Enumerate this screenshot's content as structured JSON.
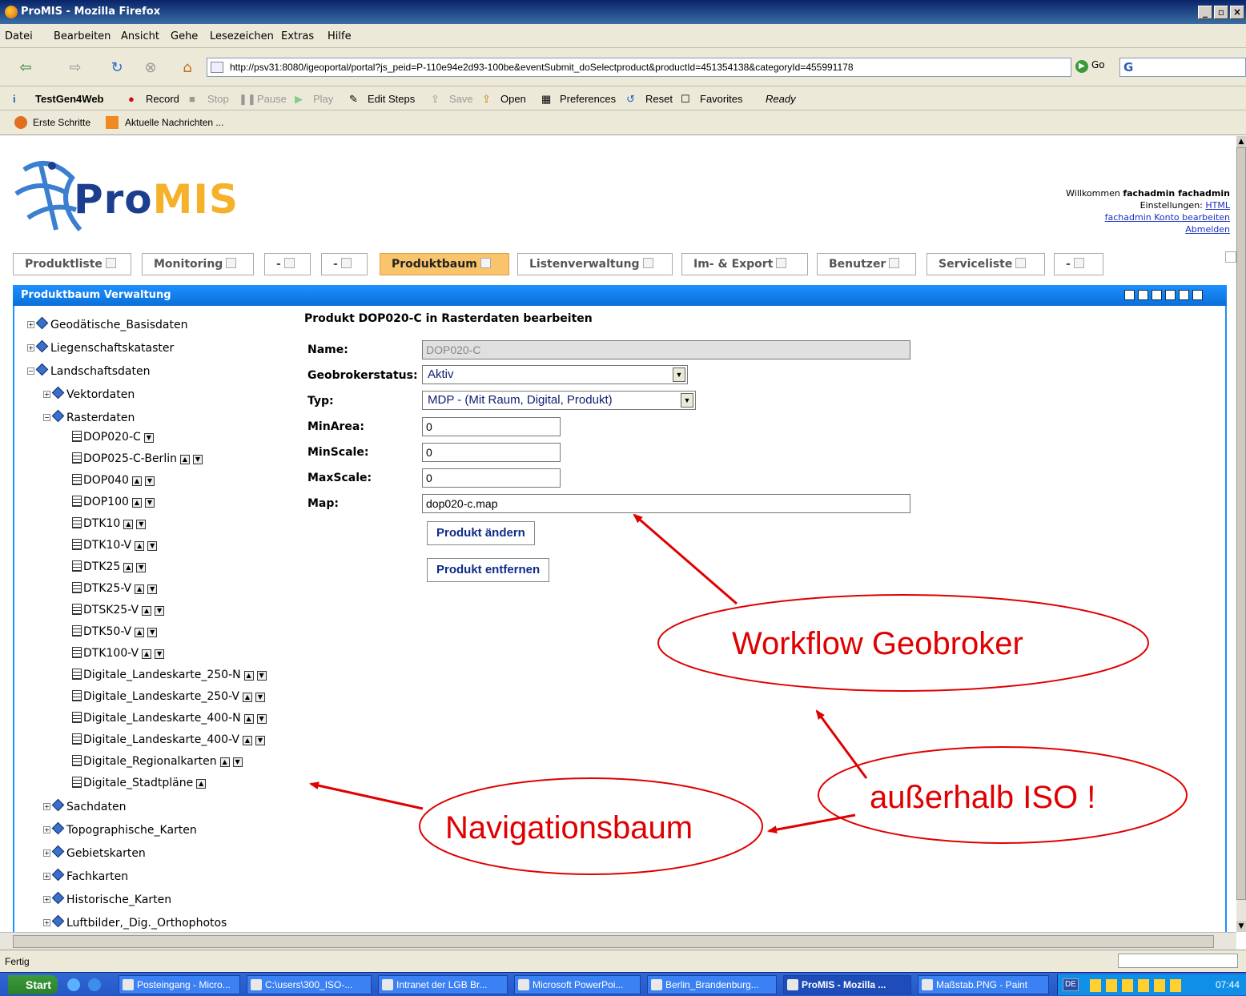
{
  "window": {
    "title": "ProMIS - Mozilla Firefox"
  },
  "menu": [
    "Datei",
    "Bearbeiten",
    "Ansicht",
    "Gehe",
    "Lesezeichen",
    "Extras",
    "Hilfe"
  ],
  "address": {
    "url": "http://psv31:8080/igeoportal/portal?js_peid=P-110e94e2d93-100be&eventSubmit_doSelectproduct&productId=451354138&categoryId=455991178",
    "go_label": "Go"
  },
  "testgen": {
    "brand": "TestGen4Web",
    "record": "Record",
    "stop": "Stop",
    "pause": "Pause",
    "play": "Play",
    "edit_steps": "Edit Steps",
    "save": "Save",
    "open": "Open",
    "preferences": "Preferences",
    "reset": "Reset",
    "favorites": "Favorites",
    "status": "Ready"
  },
  "bookmarks": [
    "Erste Schritte",
    "Aktuelle Nachrichten ..."
  ],
  "logo": {
    "pro": "Pro",
    "mis": "MIS"
  },
  "welcome": {
    "prefix": "Willkommen ",
    "user": "fachadmin fachadmin",
    "settings_label": "Einstellungen: ",
    "settings_link": "HTML",
    "account_link": "fachadmin Konto bearbeiten",
    "logout_link": "Abmelden"
  },
  "tabs": [
    "Produktliste",
    "Monitoring",
    "-",
    "-",
    "Produktbaum",
    "Listenverwaltung",
    "Im- & Export",
    "Benutzer",
    "Serviceliste",
    "-"
  ],
  "panel": {
    "title": "Produktbaum Verwaltung"
  },
  "tree": {
    "top": [
      "Geodätische_Basisdaten",
      "Liegenschaftskataster",
      "Landschaftsdaten"
    ],
    "landschaft": [
      "Vektordaten",
      "Rasterdaten"
    ],
    "raster": [
      "DOP020-C",
      "DOP025-C-Berlin",
      "DOP040",
      "DOP100",
      "DTK10",
      "DTK10-V",
      "DTK25",
      "DTK25-V",
      "DTSK25-V",
      "DTK50-V",
      "DTK100-V",
      "Digitale_Landeskarte_250-N",
      "Digitale_Landeskarte_250-V",
      "Digitale_Landeskarte_400-N",
      "Digitale_Landeskarte_400-V",
      "Digitale_Regionalkarten",
      "Digitale_Stadtpläne"
    ],
    "after": [
      "Sachdaten",
      "Topographische_Karten",
      "Gebietskarten",
      "Fachkarten",
      "Historische_Karten",
      "Luftbilder,_Dig._Orthophotos"
    ]
  },
  "form": {
    "title": "Produkt DOP020-C in Rasterdaten bearbeiten",
    "name_label": "Name:",
    "name_value": "DOP020-C",
    "status_label": "Geobrokerstatus:",
    "status_value": "Aktiv",
    "typ_label": "Typ:",
    "typ_value": "MDP - (Mit Raum, Digital, Produkt)",
    "minarea_label": "MinArea:",
    "minarea_value": "0",
    "minscale_label": "MinScale:",
    "minscale_value": "0",
    "maxscale_label": "MaxScale:",
    "maxscale_value": "0",
    "map_label": "Map:",
    "map_value": "dop020-c.map",
    "change_button": "Produkt ändern",
    "remove_button": "Produkt entfernen"
  },
  "annotations": {
    "workflow": "Workflow Geobroker",
    "iso": "außerhalb ISO !",
    "nav": "Navigationsbaum",
    "color": "#e00000"
  },
  "status": {
    "text": "Fertig"
  },
  "taskbar": {
    "start": "Start",
    "items": [
      "Posteingang - Micro...",
      "C:\\users\\300_ISO-...",
      "Intranet der LGB Br...",
      "Microsoft PowerPoi...",
      "Berlin_Brandenburg...",
      "ProMIS - Mozilla ...",
      "Maßstab.PNG - Paint"
    ],
    "lang": "DE",
    "clock": "07:44"
  }
}
